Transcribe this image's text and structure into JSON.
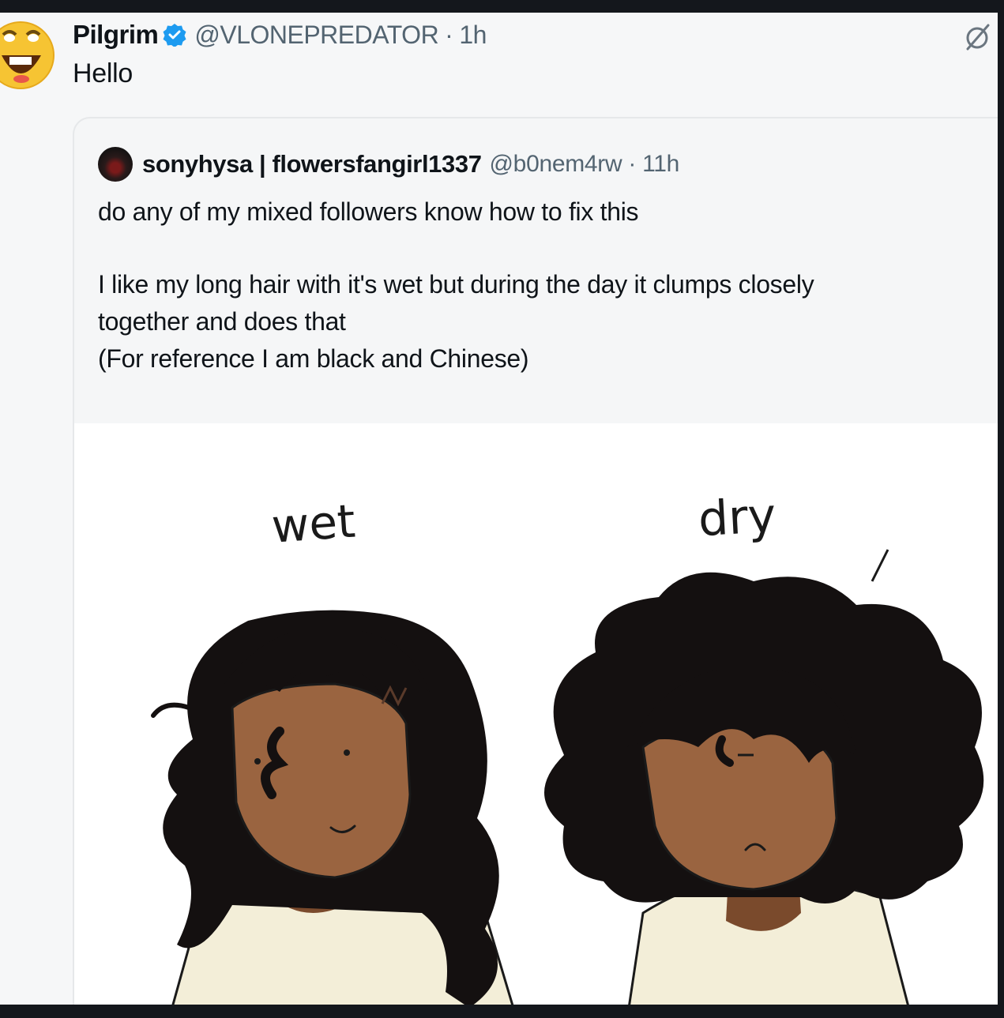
{
  "post": {
    "author_name": "Pilgrim",
    "handle": "@VLONEPREDATOR",
    "separator": "·",
    "time": "1h",
    "text": "Hello",
    "author_avatar_icon": "laughing-emoji-avatar",
    "verified_icon": "verified-badge-icon",
    "grok_icon": "slashed-circle-icon"
  },
  "quoted": {
    "author_name": "sonyhysa | flowersfangirl1337",
    "handle": "@b0nem4rw",
    "separator": "·",
    "time": "11h",
    "lines": [
      "do any of my mixed followers know how to fix this",
      "I like my long hair with it's wet but during the day it clumps closely",
      "together and does that",
      "(For reference I am black and Chinese)"
    ],
    "image": {
      "label_left": "wet",
      "label_right": "dry"
    }
  },
  "colors": {
    "background": "#f6f7f8",
    "text": "#0f1419",
    "secondary_text": "#536471",
    "verified_blue": "#1d9bf0",
    "skin": "#9a6440",
    "hair": "#141010",
    "shirt": "#f3eed8"
  }
}
